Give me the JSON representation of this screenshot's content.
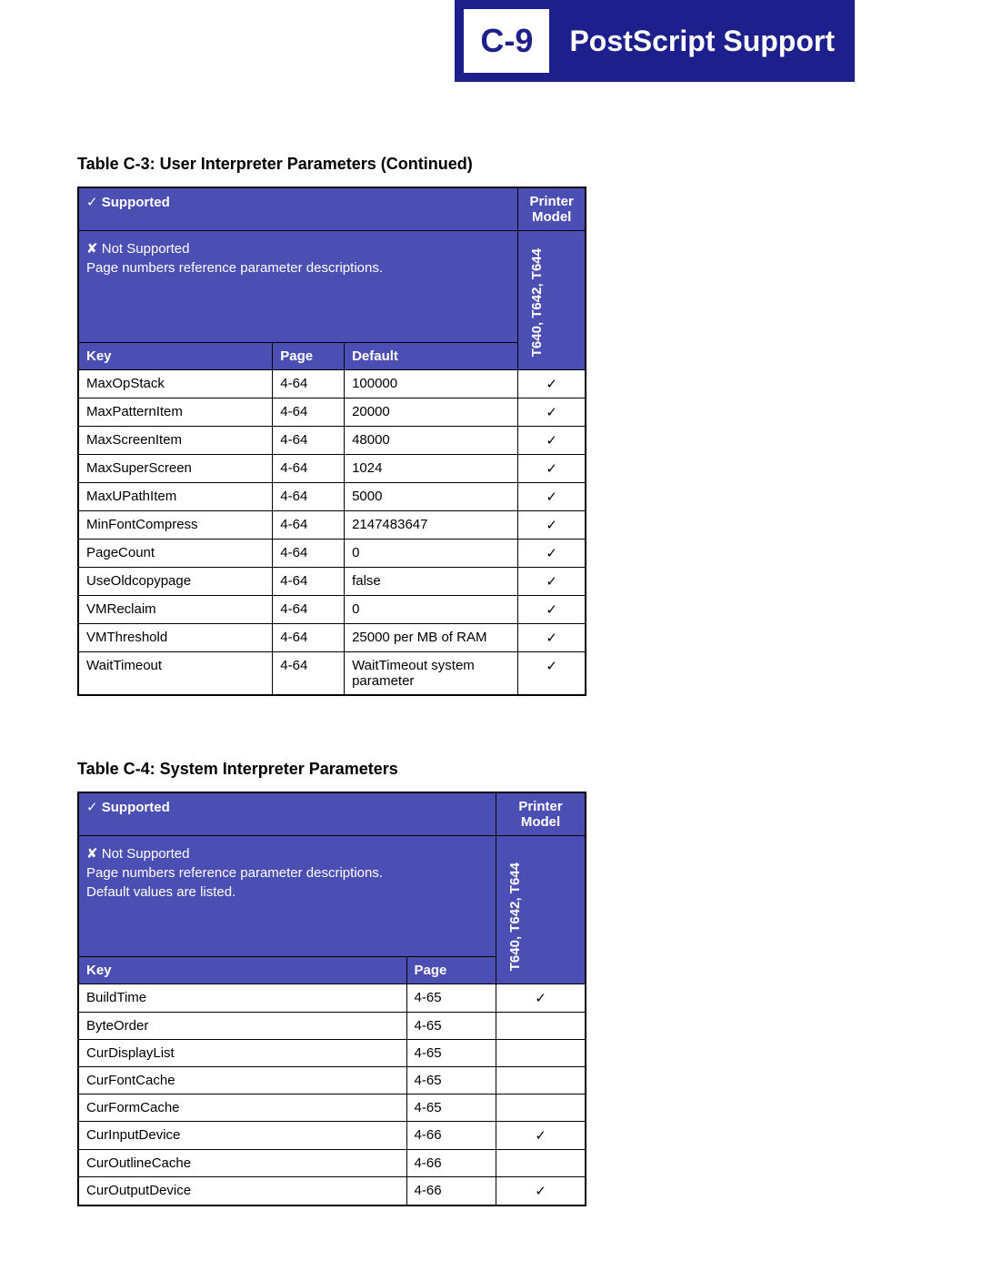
{
  "header": {
    "code": "C-9",
    "title": "PostScript Support"
  },
  "legend": {
    "supported": "Supported",
    "not_supported": "Not Supported",
    "note1": "Page numbers reference parameter descriptions.",
    "note2": "Default values are listed."
  },
  "printer_model_label": "Printer Model",
  "model_column": "T640, T642, T644",
  "columns": {
    "key": "Key",
    "page": "Page",
    "default": "Default"
  },
  "check": "✓",
  "cross": "✘",
  "table1": {
    "caption": "Table C-3:  User Interpreter Parameters (Continued)",
    "rows": [
      {
        "key": "MaxOpStack",
        "page": "4-64",
        "def": "100000",
        "sup": true
      },
      {
        "key": "MaxPatternItem",
        "page": "4-64",
        "def": "20000",
        "sup": true
      },
      {
        "key": "MaxScreenItem",
        "page": "4-64",
        "def": "48000",
        "sup": true
      },
      {
        "key": "MaxSuperScreen",
        "page": "4-64",
        "def": "1024",
        "sup": true
      },
      {
        "key": "MaxUPathItem",
        "page": "4-64",
        "def": "5000",
        "sup": true
      },
      {
        "key": "MinFontCompress",
        "page": "4-64",
        "def": "2147483647",
        "sup": true
      },
      {
        "key": "PageCount",
        "page": "4-64",
        "def": "0",
        "sup": true
      },
      {
        "key": "UseOldcopypage",
        "page": "4-64",
        "def": "false",
        "sup": true
      },
      {
        "key": "VMReclaim",
        "page": "4-64",
        "def": "0",
        "sup": true
      },
      {
        "key": "VMThreshold",
        "page": "4-64",
        "def": "25000 per MB of RAM",
        "sup": true
      },
      {
        "key": "WaitTimeout",
        "page": "4-64",
        "def": "WaitTimeout system parameter",
        "sup": true
      }
    ]
  },
  "table2": {
    "caption": "Table C-4:   System Interpreter Parameters",
    "rows": [
      {
        "key": "BuildTime",
        "page": "4-65",
        "sup": true
      },
      {
        "key": "ByteOrder",
        "page": "4-65",
        "sup": false
      },
      {
        "key": "CurDisplayList",
        "page": "4-65",
        "sup": false
      },
      {
        "key": "CurFontCache",
        "page": "4-65",
        "sup": false
      },
      {
        "key": "CurFormCache",
        "page": "4-65",
        "sup": false
      },
      {
        "key": "CurInputDevice",
        "page": "4-66",
        "sup": true
      },
      {
        "key": "CurOutlineCache",
        "page": "4-66",
        "sup": false
      },
      {
        "key": "CurOutputDevice",
        "page": "4-66",
        "sup": true
      }
    ]
  }
}
